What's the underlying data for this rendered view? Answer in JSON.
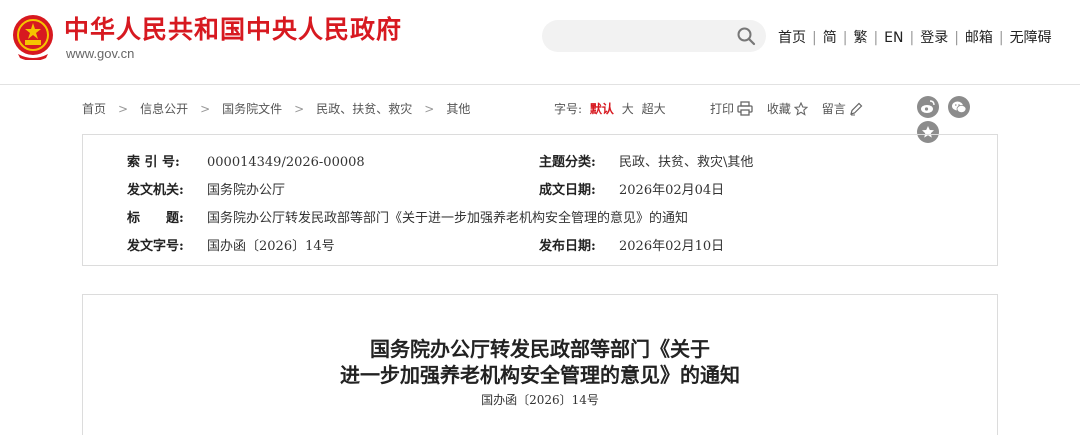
{
  "header": {
    "site_title": "中华人民共和国中央人民政府",
    "site_url": "www.gov.cn",
    "search_placeholder": "",
    "nav": [
      "首页",
      "简",
      "繁",
      "EN",
      "登录",
      "邮箱",
      "无障碍"
    ],
    "brand_color": "#d71920"
  },
  "breadcrumb": {
    "items": [
      "首页",
      "信息公开",
      "国务院文件",
      "民政、扶贫、救灾",
      "其他"
    ]
  },
  "font_size": {
    "label": "字号:",
    "options": [
      "默认",
      "大",
      "超大"
    ],
    "selected": "默认"
  },
  "tools": {
    "print": "打印",
    "favorite": "收藏",
    "comment": "留言"
  },
  "share_icons": [
    "weibo-icon",
    "wechat-icon",
    "star-icon"
  ],
  "info": {
    "index_label": "索 引 号:",
    "index_value": "000014349/2026-00008",
    "category_label": "主题分类:",
    "category_value": "民政、扶贫、救灾\\其他",
    "issuer_label": "发文机关:",
    "issuer_value": "国务院办公厅",
    "created_label": "成文日期:",
    "created_value": "2026年02月04日",
    "title_label": "标　　题:",
    "title_value": "国务院办公厅转发民政部等部门《关于进一步加强养老机构安全管理的意见》的通知",
    "docno_label": "发文字号:",
    "docno_value": "国办函〔2026〕14号",
    "published_label": "发布日期:",
    "published_value": "2026年02月10日"
  },
  "document": {
    "title_line1": "国务院办公厅转发民政部等部门《关于",
    "title_line2": "进一步加强养老机构安全管理的意见》的通知",
    "doc_number": "国办函〔2026〕14号"
  }
}
